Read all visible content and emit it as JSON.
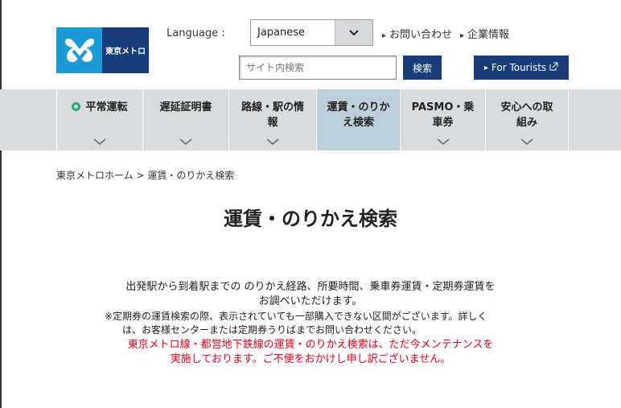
{
  "header": {
    "logo_text": "東京メトロ",
    "language_label": "Language :",
    "language_value": "Japanese",
    "links": [
      "お問い合わせ",
      "企業情報"
    ],
    "search_placeholder": "サイト内検索",
    "search_button": "検索",
    "tourists_button": "For Tourists"
  },
  "nav": {
    "items": [
      {
        "line1": "平常運転",
        "line2": ""
      },
      {
        "line1": "遅延証明書",
        "line2": ""
      },
      {
        "line1": "路線・駅の情",
        "line2": "報"
      },
      {
        "line1": "運賃・のりか",
        "line2": "え検索"
      },
      {
        "line1": "PASMO・乗",
        "line2": "車券"
      },
      {
        "line1": "安心への取",
        "line2": "組み"
      }
    ]
  },
  "breadcrumb": {
    "home": "東京メトロホーム",
    "sep": ">",
    "current": "運賃・のりかえ検索"
  },
  "main": {
    "title": "運賃・のりかえ検索",
    "desc_line1": "出発駅から到着駅までの のりかえ経路、所要時間、乗車券運賃・定期券運賃を",
    "desc_line2": "お調べいただけます。",
    "note_line1": "※定期券の運賃検索の際、表示されていても一部購入できない区間がございます。詳しく",
    "note_line2": "は、お客様センターまたは定期券うりばまでお問い合わせください。",
    "maint_line1": "東京メトロ線・都営地下鉄線の運賃・のりかえ検索は、ただ今メンテナンスを",
    "maint_line2": "実施しております。ご不便をおかけし申し訳ございません。"
  },
  "colors": {
    "navy": "#173e7a",
    "metro_blue": "#1a9ad6",
    "status_green": "#2aa875",
    "alert_red": "#e0001b"
  }
}
